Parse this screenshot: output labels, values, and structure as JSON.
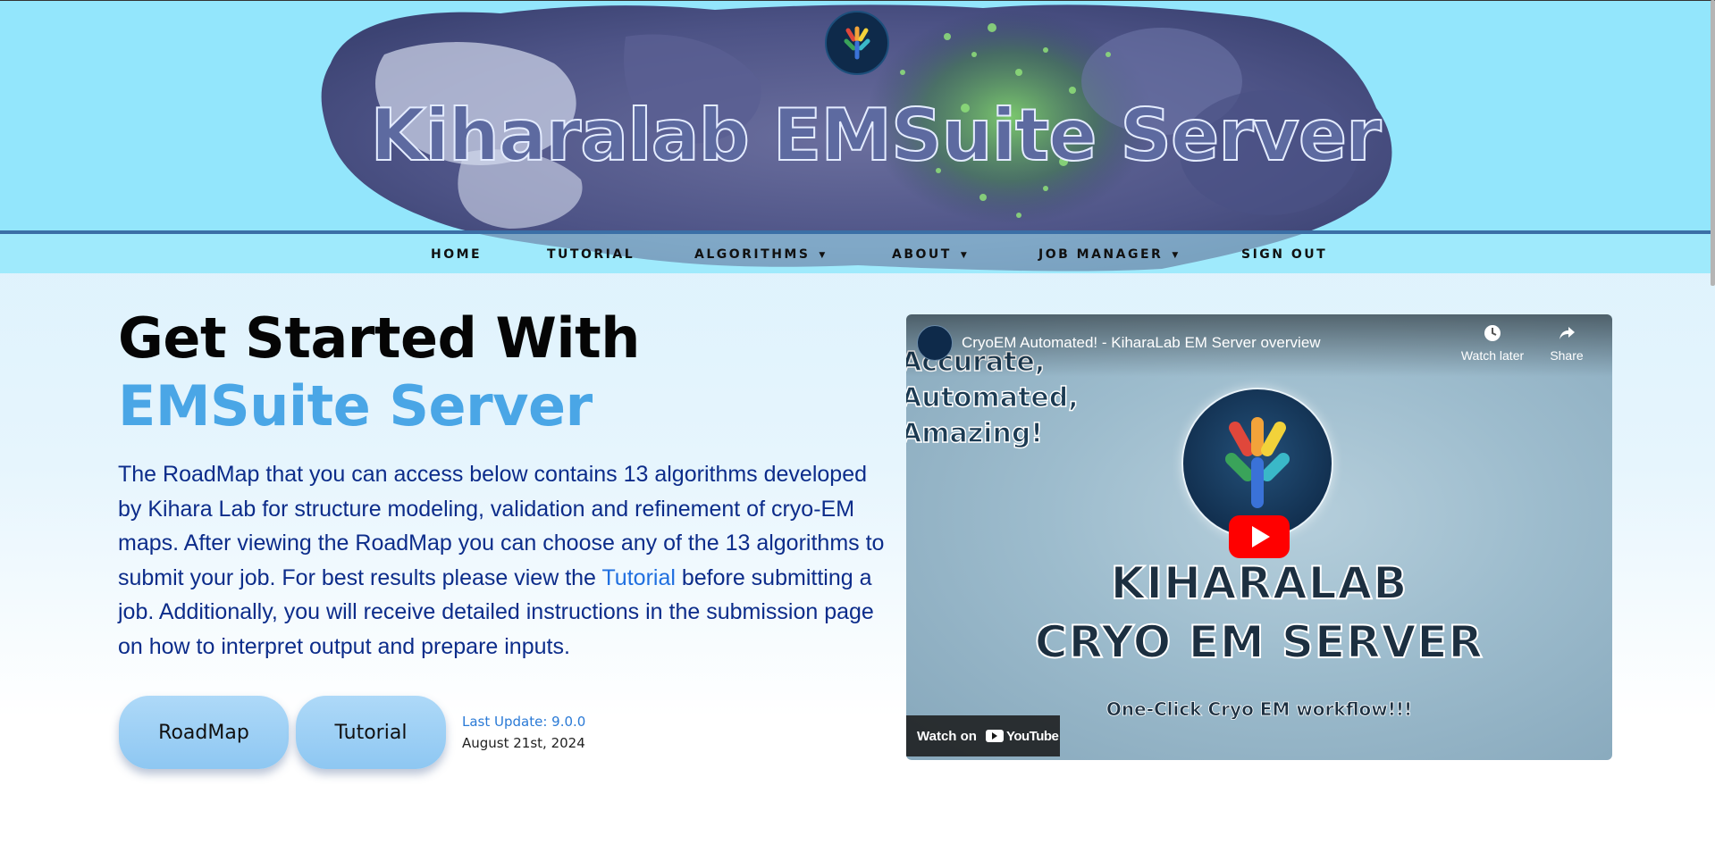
{
  "header": {
    "site_title": "Kiharalab EMSuite Server",
    "logo_icon": "tree-network-logo-icon"
  },
  "nav": {
    "items": [
      {
        "label": "HOME",
        "has_dropdown": false
      },
      {
        "label": "TUTORIAL",
        "has_dropdown": false
      },
      {
        "label": "ALGORITHMS",
        "has_dropdown": true
      },
      {
        "label": "ABOUT",
        "has_dropdown": true
      },
      {
        "label": "JOB MANAGER",
        "has_dropdown": true
      },
      {
        "label": "SIGN OUT",
        "has_dropdown": false
      }
    ],
    "dropdown_glyph": "▼"
  },
  "hero": {
    "title_line1": "Get Started With",
    "title_line2": "EMSuite Server",
    "description_before_link": "The RoadMap that you can access below contains 13 algorithms developed by Kihara Lab for structure modeling, validation and refinement of cryo-EM maps. After viewing the RoadMap you can choose any of the 13 algorithms to submit your job. For best results please view the ",
    "description_link": "Tutorial",
    "description_after_link": " before submitting a job. Additionally, you will receive detailed instructions in the submission page on how to interpret output and prepare inputs.",
    "roadmap_button": "RoadMap",
    "tutorial_button": "Tutorial",
    "last_update_label": "Last Update: 9.0.0",
    "last_update_date": "August 21st, 2024"
  },
  "video": {
    "title": "CryoEM Automated! - KiharaLab EM Server overview",
    "watch_later": "Watch later",
    "share": "Share",
    "overlay_text": "Accurate,\nAutomated,\nAmazing!",
    "headline_1": "KIHARALAB",
    "headline_2": "CRYO EM SERVER",
    "tagline": "One-Click Cryo EM workflow!!!",
    "watch_on": "Watch on",
    "youtube": "YouTube"
  },
  "colors": {
    "header_bg": "#93e6fc",
    "nav_line": "#3b6fa6",
    "title_blue": "#4aa6e6",
    "desc_text": "#0c2c8a",
    "link": "#1f6fe0",
    "button_bg": "#9dcff4"
  }
}
